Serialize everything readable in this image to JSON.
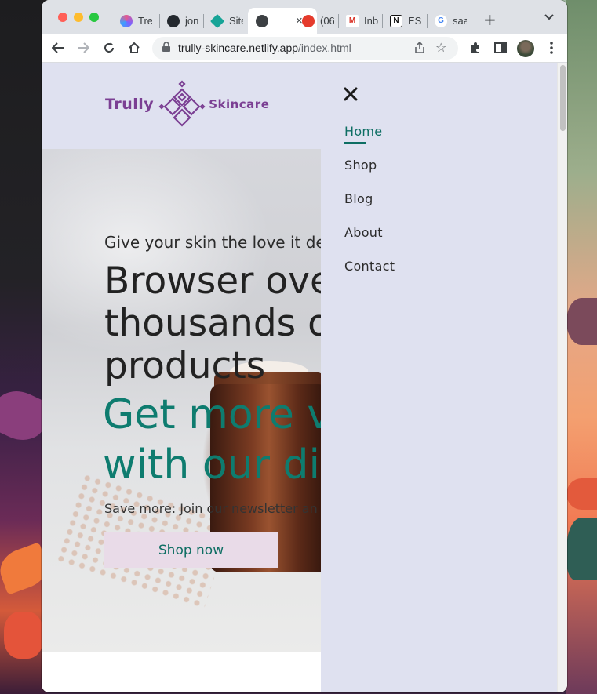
{
  "browser": {
    "tabs": [
      {
        "label": "Tre",
        "icon": "trello-icon",
        "color": "#e8598b"
      },
      {
        "label": "jon",
        "icon": "github-icon",
        "color": "#24292f"
      },
      {
        "label": "Site",
        "icon": "netlify-icon",
        "color": "#17a497"
      },
      {
        "label": "",
        "icon": "globe-icon",
        "color": "#3c4043",
        "active": true
      },
      {
        "label": "(06",
        "icon": "tomato-icon",
        "color": "#e53b2c"
      },
      {
        "label": "Inb",
        "icon": "gmail-icon",
        "color": "#d93025"
      },
      {
        "label": "ESL",
        "icon": "notion-icon",
        "color": "#111111"
      },
      {
        "label": "saa",
        "icon": "google-icon",
        "color": "#4285f4"
      }
    ],
    "url_host": "trully-skincare.netlify.app",
    "url_path": "/index.html",
    "new_tab_symbol": "+",
    "tab_close_symbol": "×"
  },
  "site": {
    "brand_word1": "Trully",
    "brand_word2": "Skincare",
    "brand_color": "#7b3f93",
    "accent_color": "#0e7c6f"
  },
  "hero": {
    "subtitle": "Give your skin the love it de",
    "title": "Browser ove\nthousands o\nproducts",
    "accent": "Get more v\nwith our di",
    "note": "Save more: Join our newsletter an",
    "cta_label": "Shop now"
  },
  "drawer": {
    "close_symbol": "✕",
    "items": [
      {
        "label": "Home",
        "active": true
      },
      {
        "label": "Shop"
      },
      {
        "label": "Blog"
      },
      {
        "label": "About"
      },
      {
        "label": "Contact"
      }
    ]
  }
}
